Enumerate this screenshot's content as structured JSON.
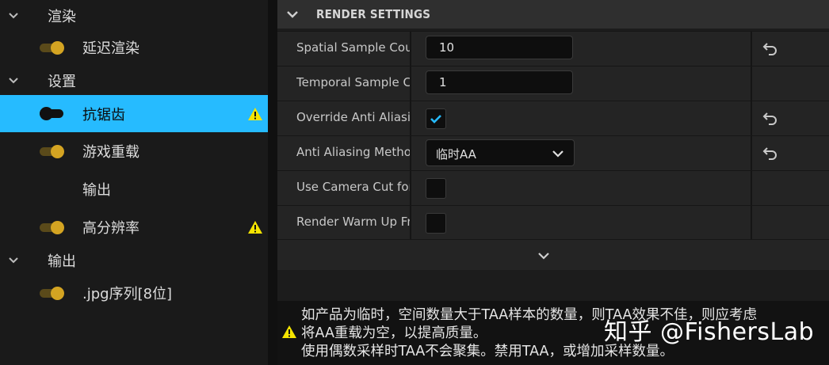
{
  "tree": {
    "items": [
      {
        "label": "渲染",
        "kind": "category",
        "expanded": true
      },
      {
        "label": "延迟渲染",
        "kind": "setting",
        "toggle": "on"
      },
      {
        "label": "设置",
        "kind": "category",
        "expanded": true
      },
      {
        "label": "抗锯齿",
        "kind": "setting",
        "toggle": "dark",
        "selected": true,
        "warning": true
      },
      {
        "label": "游戏重载",
        "kind": "setting",
        "toggle": "on"
      },
      {
        "label": "输出",
        "kind": "setting",
        "toggle": "none"
      },
      {
        "label": "高分辨率",
        "kind": "setting",
        "toggle": "on",
        "warning": true
      },
      {
        "label": "输出",
        "kind": "category",
        "expanded": true
      },
      {
        "label": ".jpg序列[8位]",
        "kind": "setting",
        "toggle": "on"
      }
    ]
  },
  "details": {
    "section_title": "RENDER SETTINGS",
    "rows": [
      {
        "label": "Spatial Sample Count",
        "type": "number",
        "value": "10",
        "reset": true
      },
      {
        "label": "Temporal Sample Count",
        "type": "number",
        "value": "1",
        "reset": false
      },
      {
        "label": "Override Anti Aliasing",
        "type": "checkbox",
        "checked": true,
        "reset": true
      },
      {
        "label": "Anti Aliasing Method",
        "type": "dropdown",
        "value": "临时AA",
        "reset": true
      },
      {
        "label": "Use Camera Cut for Warm Up",
        "type": "checkbox",
        "checked": false,
        "reset": false
      },
      {
        "label": "Render Warm Up Frames",
        "type": "checkbox",
        "checked": false,
        "reset": false
      }
    ]
  },
  "warning": {
    "line1": "如产品为临时，空间数量大于TAA样本的数量，则TAA效果不佳，则应考虑",
    "line2": "将AA重载为空，以提高质量。",
    "line3": "使用偶数采样时TAA不会聚集。禁用TAA，或增加采样数量。"
  },
  "watermark": "知乎 @FishersLab",
  "colors": {
    "accent": "#26bbff",
    "toggle_on": "#d4a422",
    "warning": "#f5e400",
    "checkmark": "#26bbff"
  },
  "icons": {
    "chevron": "chevron-down-icon",
    "warning": "warning-triangle-icon",
    "reset": "reset-arrow-icon",
    "check": "checkmark-icon"
  }
}
